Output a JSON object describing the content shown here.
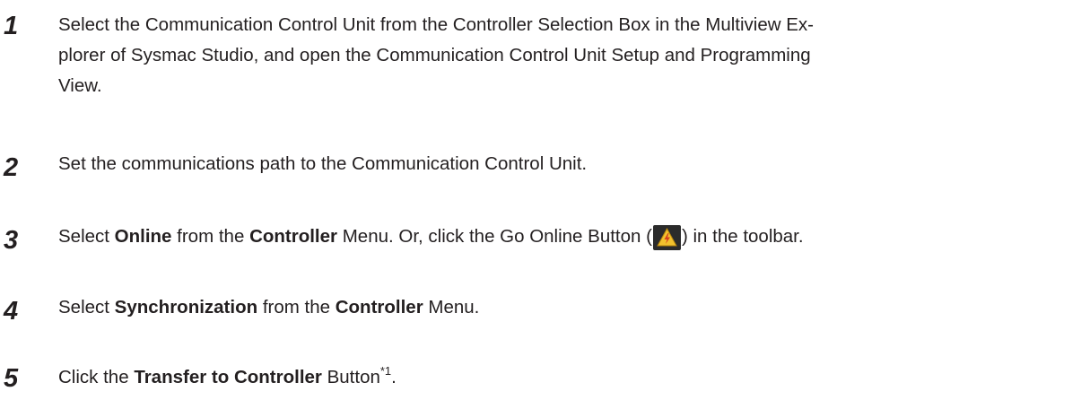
{
  "steps": [
    {
      "number": "1",
      "lines": [
        "Select the Communication Control Unit from the Controller Selection Box in the Multiview Ex-",
        "plorer of Sysmac Studio, and open the Communication Control Unit Setup and Programming",
        "View."
      ]
    },
    {
      "number": "2",
      "text": "Set the communications path to the Communication Control Unit."
    },
    {
      "number": "3",
      "t1": "Select ",
      "b1": "Online",
      "t2": " from the ",
      "b2": "Controller",
      "t3": " Menu. Or, click the Go Online Button (",
      "icon": "go-online-icon",
      "t4": ") in the toolbar."
    },
    {
      "number": "4",
      "t1": "Select ",
      "b1": "Synchronization",
      "t2": " from the ",
      "b2": "Controller",
      "t3": " Menu."
    },
    {
      "number": "5",
      "t1": "Click the ",
      "b1": "Transfer to Controller",
      "t2": " Button",
      "sup": "*1",
      "t3": "."
    }
  ],
  "colors": {
    "text": "#231f20",
    "icon_background": "#2b2b2b",
    "icon_triangle": "#f2c12e",
    "icon_bolt": "#d4411f"
  }
}
